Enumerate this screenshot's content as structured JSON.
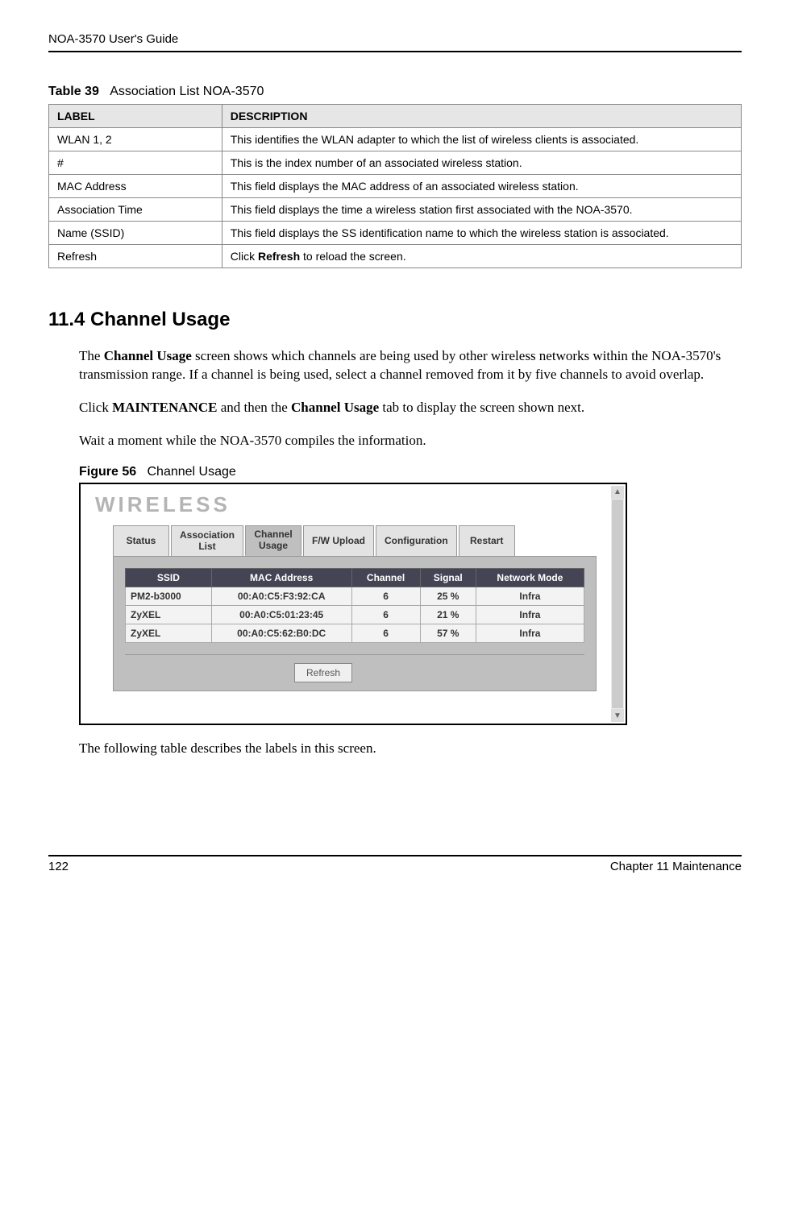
{
  "header": {
    "guide_title": "NOA-3570 User's Guide"
  },
  "table39": {
    "caption_prefix": "Table 39",
    "caption_text": "Association List NOA-3570",
    "col_label": "LABEL",
    "col_desc": "DESCRIPTION",
    "rows": [
      {
        "label": "WLAN 1, 2",
        "desc": "This identifies the WLAN adapter to which the list of wireless clients is associated."
      },
      {
        "label": "#",
        "desc": "This is the index number of an associated wireless station."
      },
      {
        "label": "MAC Address",
        "desc": "This field displays the MAC address of an associated wireless station."
      },
      {
        "label": "Association Time",
        "desc": "This field displays the time a wireless station first associated with the NOA-3570."
      },
      {
        "label": "Name (SSID)",
        "desc": "This field displays the SS identification name to which the wireless station is associated."
      },
      {
        "label": "Refresh",
        "desc_pre": "Click ",
        "desc_bold": "Refresh",
        "desc_post": " to reload the screen."
      }
    ]
  },
  "section": {
    "heading": "11.4  Channel Usage",
    "p1_pre": "The ",
    "p1_b1": "Channel Usage",
    "p1_post": " screen shows which channels are being used by other wireless networks within the NOA-3570's transmission range. If a channel is being used, select a channel removed from it by five channels to avoid overlap.",
    "p2_pre": "Click ",
    "p2_b1": "MAINTENANCE",
    "p2_mid": " and then the ",
    "p2_b2": "Channel Usage",
    "p2_post": " tab to display the screen shown next.",
    "p3": "Wait a moment while the NOA-3570 compiles the information.",
    "p4": "The following table describes the labels in this screen."
  },
  "figure": {
    "caption_prefix": "Figure 56",
    "caption_text": "Channel Usage",
    "brand": "WIRELESS",
    "tabs": {
      "status": "Status",
      "assoc1": "Association",
      "assoc2": "List",
      "chan1": "Channel",
      "chan2": "Usage",
      "fw": "F/W Upload",
      "config": "Configuration",
      "restart": "Restart"
    },
    "headers": {
      "ssid": "SSID",
      "mac": "MAC Address",
      "channel": "Channel",
      "signal": "Signal",
      "mode": "Network Mode"
    },
    "rows": [
      {
        "ssid": "PM2-b3000",
        "mac": "00:A0:C5:F3:92:CA",
        "channel": "6",
        "signal": "25 %",
        "mode": "Infra"
      },
      {
        "ssid": "ZyXEL",
        "mac": "00:A0:C5:01:23:45",
        "channel": "6",
        "signal": "21 %",
        "mode": "Infra"
      },
      {
        "ssid": "ZyXEL",
        "mac": "00:A0:C5:62:B0:DC",
        "channel": "6",
        "signal": "57 %",
        "mode": "Infra"
      }
    ],
    "refresh_label": "Refresh"
  },
  "chart_data": {
    "type": "table",
    "title": "Channel Usage",
    "columns": [
      "SSID",
      "MAC Address",
      "Channel",
      "Signal",
      "Network Mode"
    ],
    "rows": [
      [
        "PM2-b3000",
        "00:A0:C5:F3:92:CA",
        6,
        "25 %",
        "Infra"
      ],
      [
        "ZyXEL",
        "00:A0:C5:01:23:45",
        6,
        "21 %",
        "Infra"
      ],
      [
        "ZyXEL",
        "00:A0:C5:62:B0:DC",
        6,
        "57 %",
        "Infra"
      ]
    ]
  },
  "footer": {
    "page_num": "122",
    "chapter": "Chapter 11 Maintenance"
  }
}
